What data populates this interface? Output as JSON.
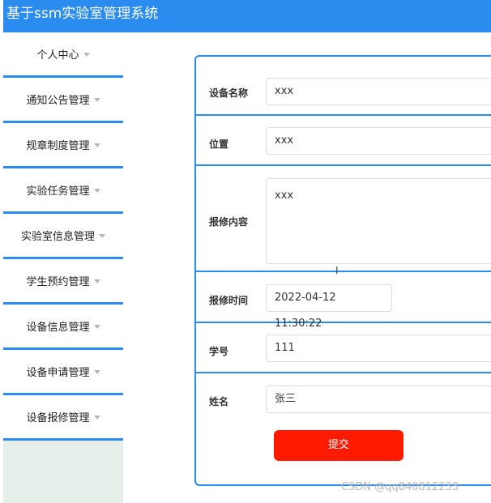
{
  "app": {
    "title": "基于ssm实验室管理系统"
  },
  "colors": {
    "accent": "#2b8cf0",
    "submit": "#ff1a00"
  },
  "sidebar": {
    "items": [
      {
        "label": "个人中心"
      },
      {
        "label": "通知公告管理"
      },
      {
        "label": "规章制度管理"
      },
      {
        "label": "实验任务管理"
      },
      {
        "label": "实验室信息管理"
      },
      {
        "label": "学生预约管理"
      },
      {
        "label": "设备信息管理"
      },
      {
        "label": "设备申请管理"
      },
      {
        "label": "设备报修管理"
      }
    ]
  },
  "form": {
    "fields": [
      {
        "label": "设备名称",
        "value": "xxx"
      },
      {
        "label": "位置",
        "value": "xxx"
      },
      {
        "label": "报修内容",
        "value": "xxx"
      },
      {
        "label": "报修时间",
        "value": "2022-04-12 11:30:22"
      },
      {
        "label": "学号",
        "value": "111"
      },
      {
        "label": "姓名",
        "value": "张三"
      }
    ],
    "submit_label": "提交"
  },
  "watermark": "CSDN @qq840812233"
}
